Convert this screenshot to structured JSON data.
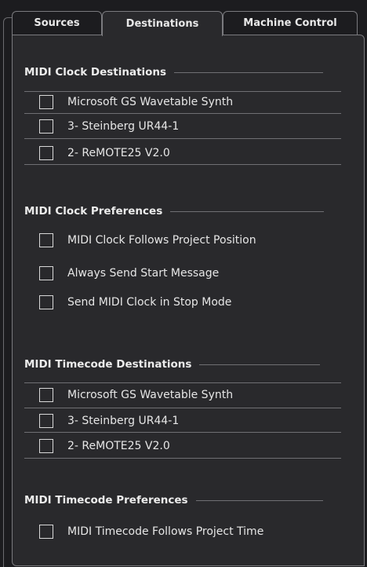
{
  "tabs": [
    "Sources",
    "Destinations",
    "Machine Control"
  ],
  "active_tab": "Destinations",
  "sections": {
    "clock_destinations": {
      "title": "MIDI Clock Destinations",
      "items": [
        "Microsoft GS Wavetable Synth",
        "3- Steinberg UR44-1",
        "2- ReMOTE25 V2.0"
      ]
    },
    "clock_preferences": {
      "title": "MIDI Clock Preferences",
      "items": [
        "MIDI Clock Follows Project Position",
        "Always Send Start Message",
        "Send MIDI Clock in Stop Mode"
      ]
    },
    "timecode_destinations": {
      "title": "MIDI Timecode Destinations",
      "items": [
        "Microsoft GS Wavetable Synth",
        "3- Steinberg UR44-1",
        "2- ReMOTE25 V2.0"
      ]
    },
    "timecode_preferences": {
      "title": "MIDI Timecode Preferences",
      "items": [
        "MIDI Timecode Follows Project Time"
      ]
    }
  },
  "checkbox_states": "all unchecked"
}
